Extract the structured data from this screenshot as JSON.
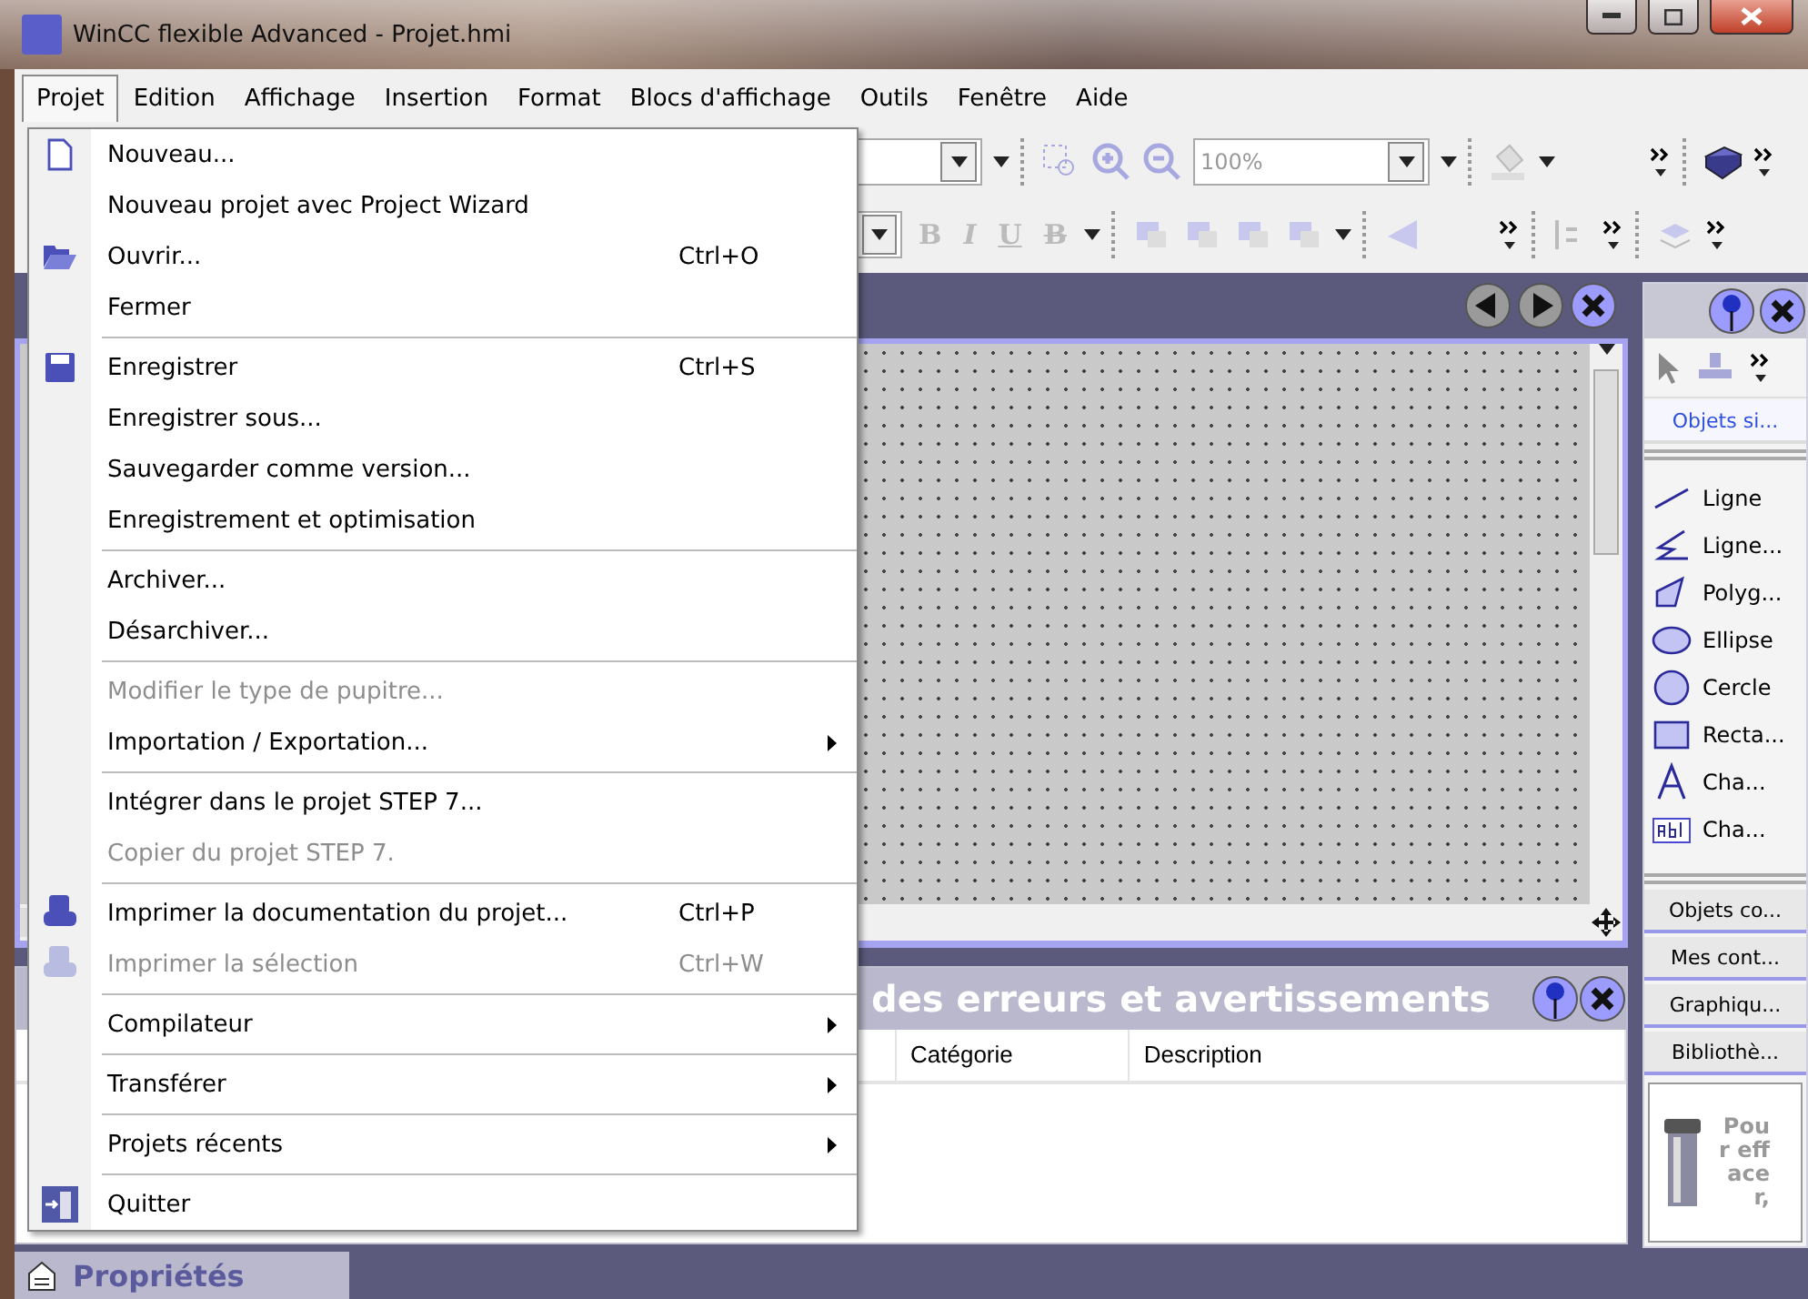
{
  "window": {
    "title": "WinCC flexible Advanced - Projet.hmi"
  },
  "menu_bar": [
    {
      "label": "Projet",
      "selected": true
    },
    {
      "label": "Edition",
      "selected": false
    },
    {
      "label": "Affichage",
      "selected": false
    },
    {
      "label": "Insertion",
      "selected": false
    },
    {
      "label": "Format",
      "selected": false
    },
    {
      "label": "Blocs d'affichage",
      "selected": false
    },
    {
      "label": "Outils",
      "selected": false
    },
    {
      "label": "Fenêtre",
      "selected": false
    },
    {
      "label": "Aide",
      "selected": false
    }
  ],
  "project_menu": {
    "sections": [
      [
        {
          "label": "Nouveau...",
          "kind": "new",
          "disabled": false,
          "submenu": false
        },
        {
          "label": "Nouveau projet avec Project Wizard",
          "disabled": false,
          "submenu": false
        },
        {
          "label": "Ouvrir...",
          "shortcut": "Ctrl+O",
          "kind": "open",
          "disabled": false,
          "submenu": false
        },
        {
          "label": "Fermer",
          "disabled": false,
          "submenu": false
        }
      ],
      [
        {
          "label": "Enregistrer",
          "shortcut": "Ctrl+S",
          "kind": "save",
          "disabled": false,
          "submenu": false
        },
        {
          "label": "Enregistrer sous...",
          "disabled": false,
          "submenu": false
        },
        {
          "label": "Sauvegarder comme version...",
          "disabled": false,
          "submenu": false
        },
        {
          "label": "Enregistrement et optimisation",
          "disabled": false,
          "submenu": false
        }
      ],
      [
        {
          "label": "Archiver...",
          "disabled": false,
          "submenu": false
        },
        {
          "label": "Désarchiver...",
          "disabled": false,
          "submenu": false
        }
      ],
      [
        {
          "label": "Modifier le type de pupitre...",
          "disabled": true,
          "submenu": false
        },
        {
          "label": "Importation / Exportation...",
          "disabled": false,
          "submenu": true
        }
      ],
      [
        {
          "label": "Intégrer dans le projet STEP 7...",
          "disabled": false,
          "submenu": false
        },
        {
          "label": "Copier du projet STEP 7.",
          "disabled": true,
          "submenu": false
        }
      ],
      [
        {
          "label": "Imprimer la documentation du projet...",
          "shortcut": "Ctrl+P",
          "kind": "print",
          "disabled": false,
          "submenu": false
        },
        {
          "label": "Imprimer la sélection",
          "shortcut": "Ctrl+W",
          "kind": "print",
          "disabled": true,
          "submenu": false
        }
      ],
      [
        {
          "label": "Compilateur",
          "disabled": false,
          "submenu": true
        }
      ],
      [
        {
          "label": "Transférer",
          "disabled": false,
          "submenu": true
        }
      ],
      [
        {
          "label": "Projets récents",
          "disabled": false,
          "submenu": true
        }
      ],
      [
        {
          "label": "Quitter",
          "kind": "exit",
          "disabled": false,
          "submenu": false
        }
      ]
    ]
  },
  "toolbar": {
    "zoom": "100%",
    "format_buttons": [
      "B",
      "I",
      "U",
      "B"
    ]
  },
  "errors_panel": {
    "title": "des erreurs et avertissements",
    "columns": [
      "Catégorie",
      "Description"
    ]
  },
  "toolbox": {
    "groups": [
      {
        "label": "Objets si...",
        "selected": true
      },
      {
        "label": "Objets co...",
        "selected": false
      },
      {
        "label": "Mes cont...",
        "selected": false
      },
      {
        "label": "Graphiqu...",
        "selected": false
      },
      {
        "label": "Bibliothè...",
        "selected": false
      }
    ],
    "items": [
      {
        "label": "Ligne",
        "kind": "line"
      },
      {
        "label": "Ligne...",
        "kind": "polyline"
      },
      {
        "label": "Polyg...",
        "kind": "polygon"
      },
      {
        "label": "Ellipse",
        "kind": "ellipse"
      },
      {
        "label": "Cercle",
        "kind": "circle"
      },
      {
        "label": "Recta...",
        "kind": "rectangle"
      },
      {
        "label": "Cha...",
        "kind": "text"
      },
      {
        "label": "Cha...",
        "kind": "textfield"
      }
    ],
    "hint": "Pour effacer,"
  },
  "properties_tab": {
    "label": "Propriétés"
  }
}
